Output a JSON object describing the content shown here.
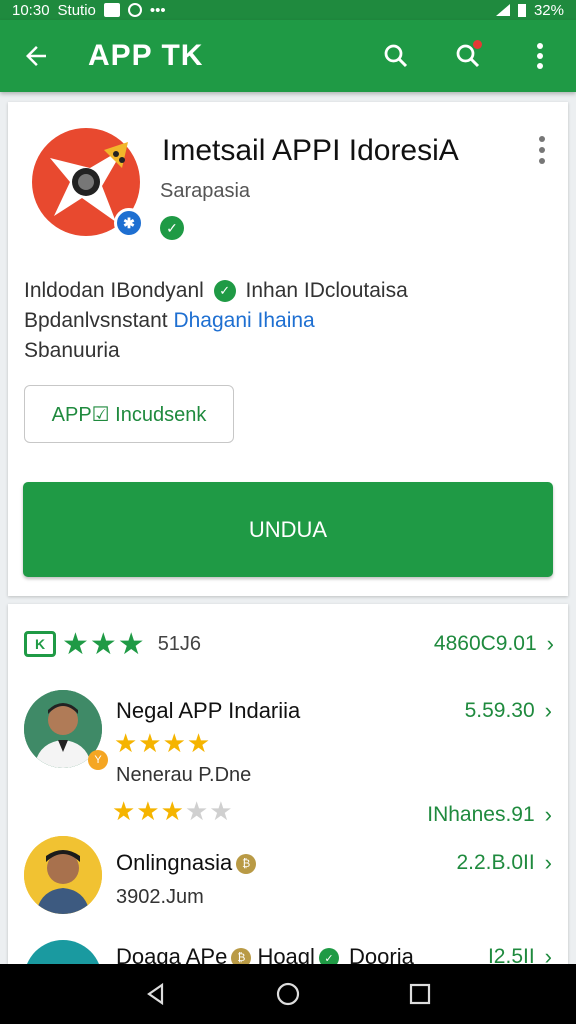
{
  "status_bar": {
    "time": "10:30",
    "carrier": "Stutio",
    "battery": "32%"
  },
  "app_bar": {
    "title": "APP TK",
    "back_icon": "arrow-left-icon",
    "search_icon": "search-icon",
    "notify_search_icon": "search-notification-icon",
    "menu_icon": "kebab-menu-icon",
    "accent": "#1f9a45"
  },
  "app": {
    "title": "Imetsail APPI IdoresiA",
    "developer": "Sarapasia",
    "meta_line1_a": "Inldodan IBondyanl",
    "meta_line1_b": "Inhan IDcloutaisa",
    "meta_line2_a": "Bpdanlvsnstant",
    "meta_line2_link": "Dhagani Ihaina",
    "meta_line3": "Sbanuuria",
    "chip_label": "APP☑ Incudsenk",
    "install_label": "UNDUA"
  },
  "reviews": {
    "summary": {
      "stars": "★★★",
      "count": "51J6",
      "value": "4860C9.01"
    },
    "items": [
      {
        "name": "Negal APP Indariia",
        "stars_on": "★★★★",
        "stars_off": "",
        "value": "5.59.30",
        "sub": "Nenerau P.Dne",
        "sub_stars_on": "★★★",
        "sub_stars_off": "★★",
        "sub_value": "INhanes.91"
      },
      {
        "name": "Onlingnasia",
        "sub": "3902.Jum",
        "value": "2.2.B.0II"
      },
      {
        "name_a": "Doaga APe",
        "name_b": "Hoagl",
        "name_c": "Dooria",
        "value": "I2.5II"
      }
    ]
  },
  "nav": {
    "back_icon": "nav-back-icon",
    "home_icon": "nav-home-icon",
    "recents_icon": "nav-recents-icon"
  }
}
